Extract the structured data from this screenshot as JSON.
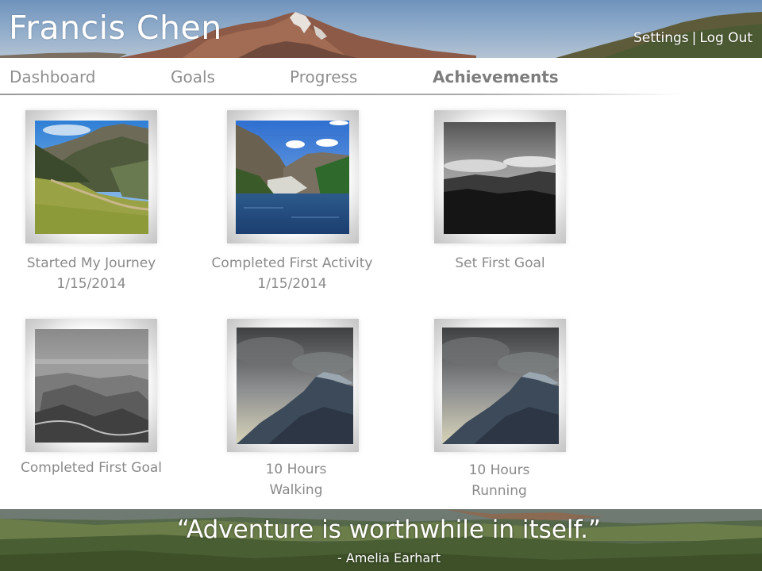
{
  "header": {
    "user_name": "Francis Chen",
    "settings_label": "Settings",
    "separator": "|",
    "logout_label": "Log Out"
  },
  "nav": {
    "items": [
      {
        "label": "Dashboard"
      },
      {
        "label": "Goals"
      },
      {
        "label": "Progress"
      },
      {
        "label": "Achievements"
      }
    ],
    "active": "Achievements"
  },
  "achievements": [
    {
      "title": "Started My Journey",
      "date": "1/15/2014",
      "image": "mountain-valley-photo"
    },
    {
      "title": "Completed First Activity",
      "date": "1/15/2014",
      "image": "mountain-lake-photo"
    },
    {
      "title": "Set First Goal",
      "date": "",
      "image": "grayscale-hills-photo"
    },
    {
      "title": "Completed First Goal",
      "date": "",
      "image": "grayscale-canyon-photo"
    },
    {
      "title": "10 Hours",
      "subtitle": "Walking",
      "image": "cloudy-peak-photo"
    },
    {
      "title": "10 Hours",
      "subtitle": "Running",
      "image": "cloudy-peak-photo"
    }
  ],
  "footer": {
    "quote": "“Adventure is worthwhile in itself.”",
    "attribution": "- Amelia Earhart"
  },
  "colors": {
    "nav_text": "#8f8f8f",
    "caption_text": "#8a8a8a",
    "header_text": "#ffffff"
  }
}
